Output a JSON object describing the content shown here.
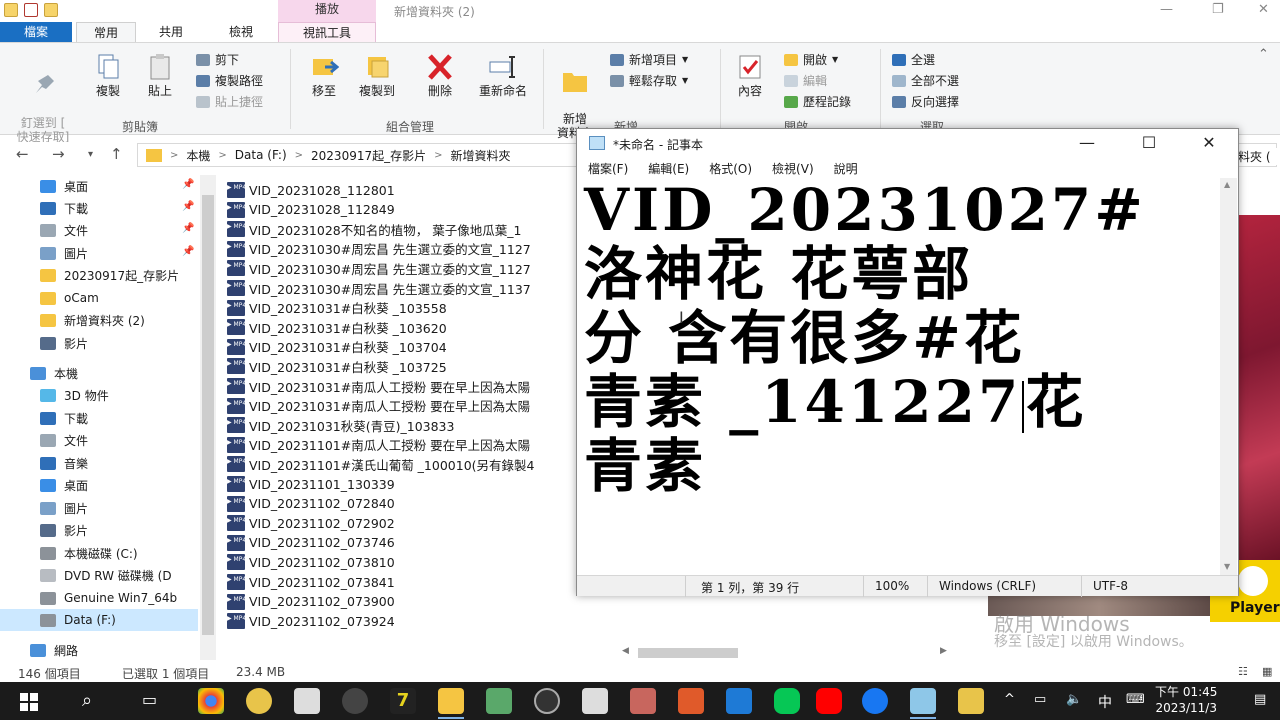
{
  "explorer": {
    "window_title": "新增資料夾 (2)",
    "context_tab_group": "播放",
    "tabs": [
      "檔案",
      "常用",
      "共用",
      "檢視",
      "視訊工具"
    ],
    "ribbon": {
      "pin_label": "釘選到 [\n快速存取]",
      "copy_label": "複製",
      "paste_label": "貼上",
      "cut_label": "剪下",
      "copy_path_label": "複製路徑",
      "paste_shortcut_label": "貼上捷徑",
      "clipboard_group": "剪貼簿",
      "move_to_label": "移至",
      "copy_to_label": "複製到",
      "delete_label": "刪除",
      "rename_label": "重新命名",
      "organize_group": "組合管理",
      "new_folder_label": "新增\n資料夾",
      "new_item_label": "新增項目",
      "easy_access_label": "輕鬆存取",
      "new_group": "新增",
      "properties_label": "內容",
      "open_label": "開啟",
      "edit_label": "編輯",
      "history_label": "歷程記錄",
      "open_group": "開啟",
      "select_all_label": "全選",
      "select_none_label": "全部不選",
      "invert_label": "反向選擇",
      "select_group": "選取"
    },
    "breadcrumb": [
      "本機",
      "Data (F:)",
      "20230917起_存影片",
      "新增資料夾"
    ],
    "breadcrumb_tail": "料夾 (",
    "nav_items": [
      {
        "label": "桌面",
        "icon": "desktop-icon",
        "pinned": true
      },
      {
        "label": "下載",
        "icon": "download-icon",
        "pinned": true
      },
      {
        "label": "文件",
        "icon": "documents-icon",
        "pinned": true
      },
      {
        "label": "圖片",
        "icon": "pictures-icon",
        "pinned": true
      },
      {
        "label": "20230917起_存影片",
        "icon": "folder-icon",
        "pinned": false
      },
      {
        "label": "oCam",
        "icon": "folder-icon",
        "pinned": false
      },
      {
        "label": "新增資料夾 (2)",
        "icon": "folder-icon",
        "pinned": false
      },
      {
        "label": "影片",
        "icon": "videos-icon",
        "pinned": false
      },
      {
        "label": "本機",
        "icon": "this-pc-icon",
        "pinned": false
      },
      {
        "label": "3D 物件",
        "icon": "3d-objects-icon",
        "pinned": false
      },
      {
        "label": "下載",
        "icon": "download-icon",
        "pinned": false
      },
      {
        "label": "文件",
        "icon": "documents-icon",
        "pinned": false
      },
      {
        "label": "音樂",
        "icon": "music-icon",
        "pinned": false
      },
      {
        "label": "桌面",
        "icon": "desktop-icon",
        "pinned": false
      },
      {
        "label": "圖片",
        "icon": "pictures-icon",
        "pinned": false
      },
      {
        "label": "影片",
        "icon": "videos-icon",
        "pinned": false
      },
      {
        "label": "本機磁碟 (C:)",
        "icon": "drive-icon",
        "pinned": false
      },
      {
        "label": "DVD RW 磁碟機 (D",
        "icon": "dvd-drive-icon",
        "pinned": false
      },
      {
        "label": "Genuine Win7_64b",
        "icon": "drive-icon",
        "pinned": false
      },
      {
        "label": "Data (F:)",
        "icon": "drive-icon",
        "pinned": false,
        "selected": true
      },
      {
        "label": "網路",
        "icon": "network-icon",
        "pinned": false
      }
    ],
    "files": [
      "VID_20231028_112801",
      "VID_20231028_112849",
      "VID_20231028不知名的植物， 葉子像地瓜葉_1",
      "VID_20231030#周宏昌 先生選立委的文宣_1127",
      "VID_20231030#周宏昌 先生選立委的文宣_1127",
      "VID_20231030#周宏昌 先生選立委的文宣_1137",
      "VID_20231031#白秋葵 _103558",
      "VID_20231031#白秋葵 _103620",
      "VID_20231031#白秋葵 _103704",
      "VID_20231031#白秋葵 _103725",
      "VID_20231031#南瓜人工授粉 要在早上因為太陽",
      "VID_20231031#南瓜人工授粉 要在早上因為太陽",
      "VID_20231031秋葵(青豆)_103833",
      "VID_20231101#南瓜人工授粉 要在早上因為太陽",
      "VID_20231101#漢氏山葡萄 _100010(另有錄製4",
      "VID_20231101_130339",
      "VID_20231102_072840",
      "VID_20231102_072902",
      "VID_20231102_073746",
      "VID_20231102_073810",
      "VID_20231102_073841",
      "VID_20231102_073900",
      "VID_20231102_073924"
    ],
    "status": {
      "count": "146 個項目",
      "selected": "已選取 1 個項目",
      "size": "23.4 MB"
    }
  },
  "notepad": {
    "title": "*未命名 - 記事本",
    "menu": [
      "檔案(F)",
      "編輯(E)",
      "格式(O)",
      "檢視(V)",
      "說明"
    ],
    "text_lines": [
      "VID_20231027#",
      "洛神花 花萼部",
      "分 含有很多#花"
    ],
    "line4_before_caret": "青素 _141227",
    "line4_after_caret": "花",
    "text_line5": "青素",
    "status": {
      "position": "第 1 列，第 39 行",
      "zoom": "100%",
      "eol": "Windows (CRLF)",
      "encoding": "UTF-8"
    }
  },
  "background": {
    "player_label": "Player",
    "watermark_title": "啟用 Windows",
    "watermark_sub": "移至 [設定] 以啟用 Windows。"
  },
  "taskbar": {
    "ime": "中",
    "time": "下午 01:45",
    "date": "2023/11/3"
  },
  "colors": {
    "file_tab": "#1a6fc3",
    "context_tab": "#f7d7ec",
    "selection": "#cce8ff",
    "taskbar": "#1b1b1b"
  }
}
